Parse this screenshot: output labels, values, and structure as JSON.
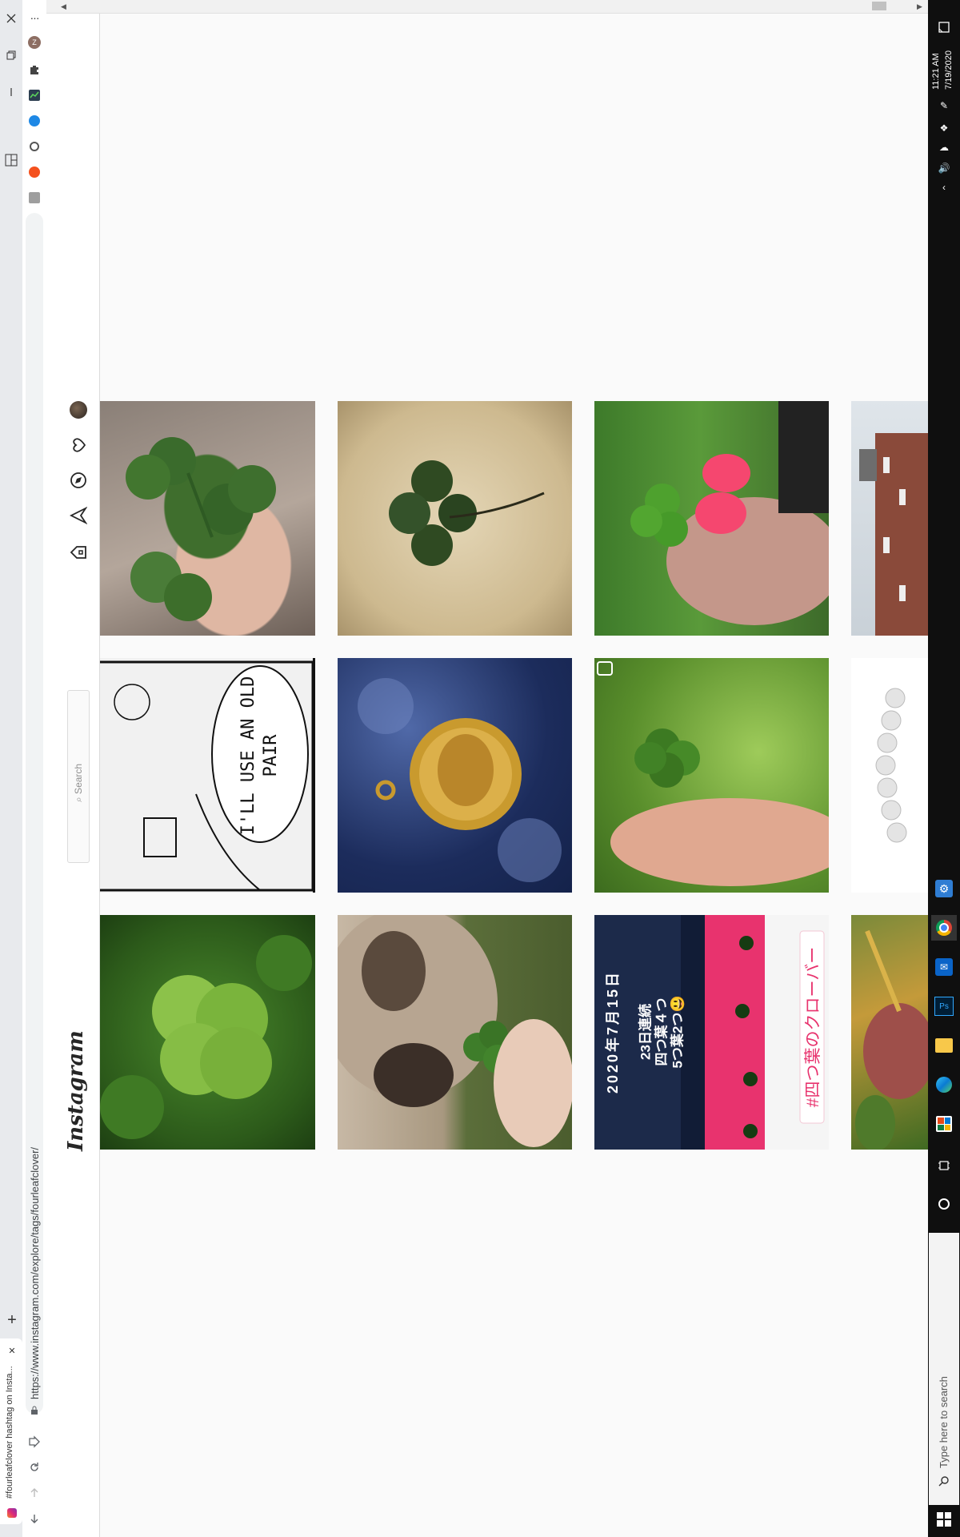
{
  "browser": {
    "tab_title": "#fourleafclover hashtag on Insta...",
    "url": "https://www.instagram.com/explore/tags/fourleafclover/",
    "profile_initial": "Z",
    "extension_icons": [
      "puzzle-icon",
      "chart-extension-icon",
      "blue-extension-icon",
      "circle-extension-icon",
      "orange-extension-icon",
      "gray-extension-icon"
    ],
    "more_label": "···",
    "new_tab_label": "+",
    "close_tab_label": "✕"
  },
  "instagram": {
    "logo": "Instagram",
    "search": {
      "placeholder": "Search"
    },
    "nav_icons": [
      "home-icon",
      "direct-icon",
      "explore-icon",
      "activity-icon",
      "profile-avatar"
    ],
    "tiles": [
      {
        "id": "clover-hand",
        "caption": ""
      },
      {
        "id": "pressed-clover",
        "caption": ""
      },
      {
        "id": "clover-pink-nails",
        "caption": ""
      },
      {
        "id": "brick-building",
        "caption": ""
      },
      {
        "id": "comic-panel",
        "caption": "I'LL USE AN OLD PAIR"
      },
      {
        "id": "gold-medallion",
        "caption": ""
      },
      {
        "id": "clover-grass",
        "caption": ""
      },
      {
        "id": "white-bracelet",
        "caption": ""
      },
      {
        "id": "green-clover",
        "caption": ""
      },
      {
        "id": "pug-clover",
        "caption": ""
      },
      {
        "id": "japanese-post",
        "caption": ""
      },
      {
        "id": "red-leaf",
        "caption": ""
      }
    ],
    "japanese_post": {
      "date": "2020年7月15日",
      "line1": "23日連続",
      "line2": "四つ葉４つ",
      "line3": "5つ葉2つ",
      "emoji": "😃",
      "tag": "#四つ葉のクローバー"
    }
  },
  "taskbar": {
    "search_placeholder": "Type here to search",
    "time": "11:21 AM",
    "date": "7/19/2020",
    "apps": [
      "settings-app",
      "chrome-app",
      "outlook-app",
      "photoshop-app",
      "file-explorer-app",
      "edge-app",
      "office-app",
      "task-view-icon",
      "cortana-icon"
    ]
  },
  "colors": {
    "taskbar_bg": "#0f0f0f",
    "browser_bg": "#e8eaed",
    "page_bg": "#fafafa",
    "accent_blue": "#1a73e8"
  }
}
